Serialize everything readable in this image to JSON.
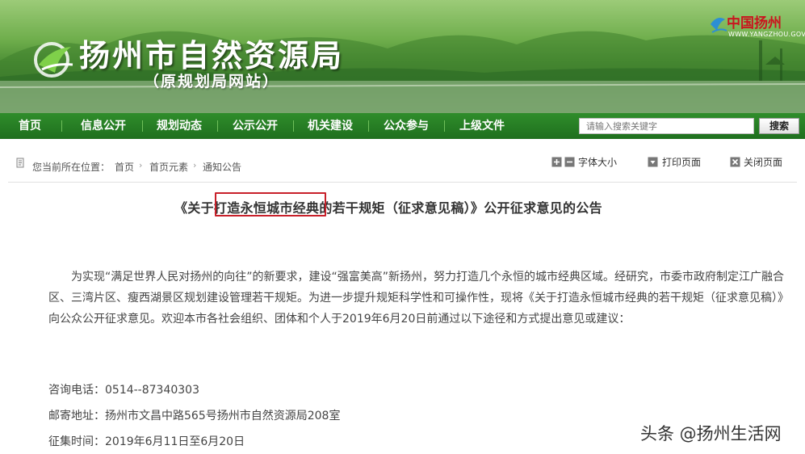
{
  "header": {
    "title": "扬州市自然资源局",
    "subtitle": "（原规划局网站）",
    "brand_name": "中国扬州",
    "brand_domain": "WWW.YANGZHOU.GOV.CN"
  },
  "nav": {
    "items": [
      "首页",
      "信息公开",
      "规划动态",
      "公示公开",
      "机关建设",
      "公众参与",
      "上级文件"
    ],
    "search_placeholder": "请输入搜索关键字",
    "search_button": "搜索"
  },
  "breadcrumb": {
    "prefix": "您当前所在位置：",
    "items": [
      "首页",
      "首页元素",
      "通知公告"
    ]
  },
  "tools": {
    "font_size": "字体大小",
    "print": "打印页面",
    "close": "关闭页面"
  },
  "article": {
    "title_pre": "《关于",
    "title_highlight": "打造永恒城市经典",
    "title_post": "的若干规矩（征求意见稿）》公开征求意见的公告",
    "body": "为实现“满足世界人民对扬州的向往”的新要求，建设“强富美高”新扬州，努力打造几个永恒的城市经典区域。经研究，市委市政府制定江广融合区、三湾片区、瘦西湖景区规划建设管理若干规矩。为进一步提升规矩科学性和可操作性，现将《关于打造永恒城市经典的若干规矩（征求意见稿）》向公众公开征求意见。欢迎本市各社会组织、团体和个人于2019年6月20日前通过以下途径和方式提出意见或建议：",
    "phone": "咨询电话：0514--87340303",
    "address": "邮寄地址：扬州市文昌中路565号扬州市自然资源局208室",
    "period": "征集时间：2019年6月11日至6月20日"
  },
  "watermark": "头条 @扬州生活网",
  "colors": {
    "nav_green": "#1f6f1e",
    "highlight_red": "#c8202a",
    "brand_red": "#c9151e"
  }
}
